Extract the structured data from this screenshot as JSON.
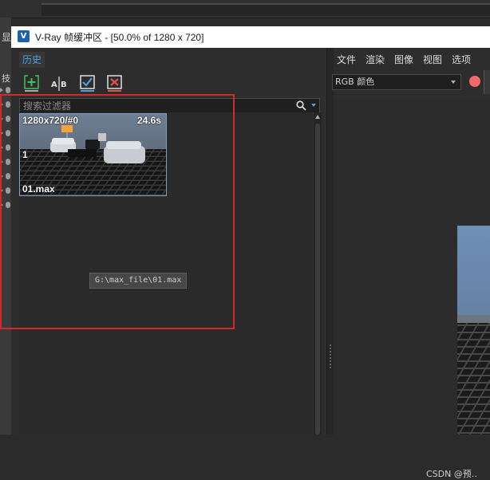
{
  "host": {
    "left_label": "显",
    "left_label_2": "技"
  },
  "window": {
    "title": "V-Ray 帧缓冲区 - [50.0% of 1280 x 720]",
    "icon": "vray-logo-icon"
  },
  "history": {
    "tab_label": "历史",
    "toolbar": [
      {
        "name": "save-to-history-button",
        "icon": "add-image-icon",
        "color": "#3ec25a"
      },
      {
        "name": "ab-compare-button",
        "icon": "ab-compare-icon",
        "label": "A|B"
      },
      {
        "name": "load-button",
        "icon": "check-image-icon",
        "color": "#4aa3df"
      },
      {
        "name": "remove-button",
        "icon": "delete-image-icon",
        "color": "#e05050"
      }
    ],
    "search": {
      "placeholder": "搜索过滤器",
      "value": ""
    },
    "items": [
      {
        "resolution": "1280x720/#0",
        "time": "24.6s",
        "index": "1",
        "name": "01.max"
      }
    ],
    "tooltip": "G:\\max_file\\01.max"
  },
  "menu": {
    "items": [
      "文件",
      "渲染",
      "图像",
      "视图",
      "选项"
    ]
  },
  "channel": {
    "selected": "RGB 颜色"
  },
  "watermark": "CSDN @预..",
  "colors": {
    "accent": "#4aa3df",
    "highlight_border": "#d22a2a",
    "record_dot": "#f06a6a"
  }
}
